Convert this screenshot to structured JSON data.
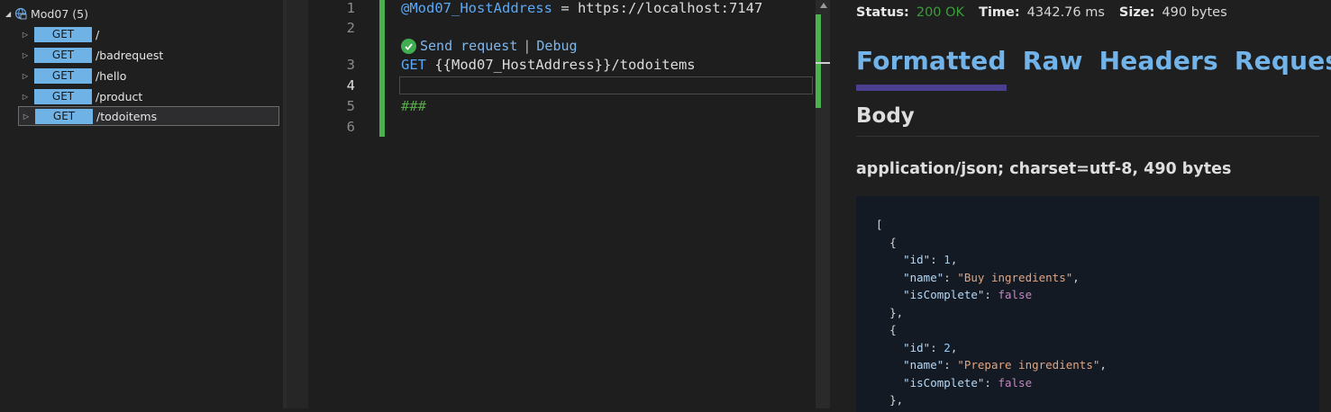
{
  "tree": {
    "root_label": "Mod07 (5)",
    "items": [
      {
        "method": "GET",
        "path": "/"
      },
      {
        "method": "GET",
        "path": "/badrequest"
      },
      {
        "method": "GET",
        "path": "/hello"
      },
      {
        "method": "GET",
        "path": "/product"
      },
      {
        "method": "GET",
        "path": "/todoitems"
      }
    ]
  },
  "editor": {
    "line_numbers": [
      "1",
      "2",
      "3",
      "4",
      "5",
      "6"
    ],
    "line1_var": "@Mod07_HostAddress",
    "line1_rest": " = https://localhost:7147",
    "codelens_send": "Send request",
    "codelens_sep": "|",
    "codelens_debug": "Debug",
    "line3_method": "GET",
    "line3_var": "{{Mod07_HostAddress}}",
    "line3_path": "/todoitems",
    "line5_comment": "###"
  },
  "response": {
    "status_label": "Status:",
    "status_value": "200 OK",
    "time_label": "Time:",
    "time_value": "4342.76 ms",
    "size_label": "Size:",
    "size_value": "490 bytes",
    "tabs": [
      "Formatted",
      "Raw",
      "Headers",
      "Request"
    ],
    "body_heading": "Body",
    "content_type": "application/json; charset=utf-8, 490 bytes",
    "json": {
      "open_bracket": "[",
      "open_brace": "{",
      "close_brace_comma": "},",
      "k_id": "\"id\"",
      "k_name": "\"name\"",
      "k_complete": "\"isComplete\"",
      "item1_id": "1",
      "item1_name": "\"Buy ingredients\"",
      "item1_complete": "false",
      "item2_id": "2",
      "item2_name": "\"Prepare ingredients\"",
      "item2_complete": "false"
    }
  },
  "colors": {
    "accent_green": "#4caf50",
    "link_blue": "#72b3ea",
    "method_badge": "#6fb2e6",
    "tab_underline": "#4a3f8f"
  }
}
